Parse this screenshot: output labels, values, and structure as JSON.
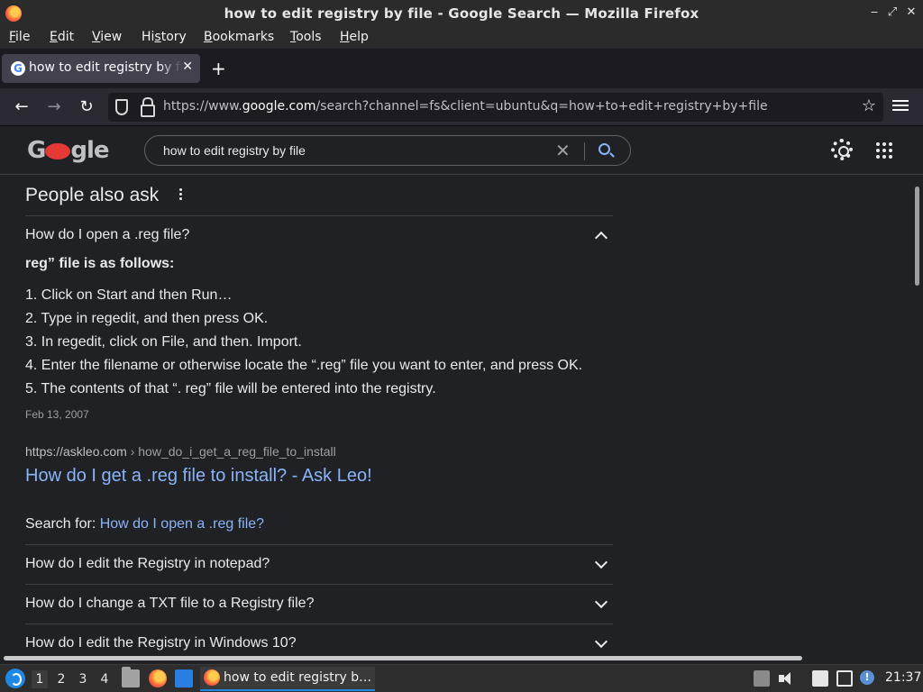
{
  "window": {
    "title": "how to edit registry by file - Google Search — Mozilla Firefox",
    "controls": [
      "minimize",
      "maximize",
      "close"
    ]
  },
  "menubar": [
    {
      "label": "File",
      "accel": "F"
    },
    {
      "label": "Edit",
      "accel": "E"
    },
    {
      "label": "View",
      "accel": "V"
    },
    {
      "label": "History",
      "accel": "s"
    },
    {
      "label": "Bookmarks",
      "accel": "B"
    },
    {
      "label": "Tools",
      "accel": "T"
    },
    {
      "label": "Help",
      "accel": "H"
    }
  ],
  "tabs": [
    {
      "title": "how to edit registry by file - Google Search",
      "active": true,
      "favicon": "google-icon"
    }
  ],
  "nav": {
    "url_prefix": "https://www.",
    "url_host": "google.com",
    "url_path": "/search?channel=fs&client=ubuntu&q=how+to+edit+registry+by+file"
  },
  "google": {
    "search_query": "how to edit registry by file",
    "logo_text": "Google"
  },
  "paa": {
    "heading": "People also ask",
    "expanded_question": "How do I open a .reg file?",
    "answer_heading": "reg” file is as follows:",
    "steps": [
      "1. Click on Start and then Run…",
      "2. Type in regedit, and then press OK.",
      "3. In regedit, click on File, and then. Import.",
      "4. Enter the filename or otherwise locate the “.reg” file you want to enter, and press OK.",
      "5. The contents of that “. reg” file will be entered into the registry."
    ],
    "date": "Feb 13, 2007",
    "source_domain": "https://askleo.com",
    "source_path": " › how_do_i_get_a_reg_file_to_install",
    "result_title": "How do I get a .reg file to install? - Ask Leo!",
    "search_for_label": "Search for: ",
    "search_for_link": "How do I open a .reg file?",
    "collapsed_questions": [
      "How do I edit the Registry in notepad?",
      "How do I change a TXT file to a Registry file?",
      "How do I edit the Registry in Windows 10?"
    ]
  },
  "taskbar": {
    "workspaces": [
      "1",
      "2",
      "3",
      "4"
    ],
    "active_workspace": "1",
    "active_task": "how to edit registry b…",
    "clock": "21:37"
  },
  "colors": {
    "link": "#8ab4f8",
    "background": "#202124",
    "text": "#e8eaed"
  }
}
